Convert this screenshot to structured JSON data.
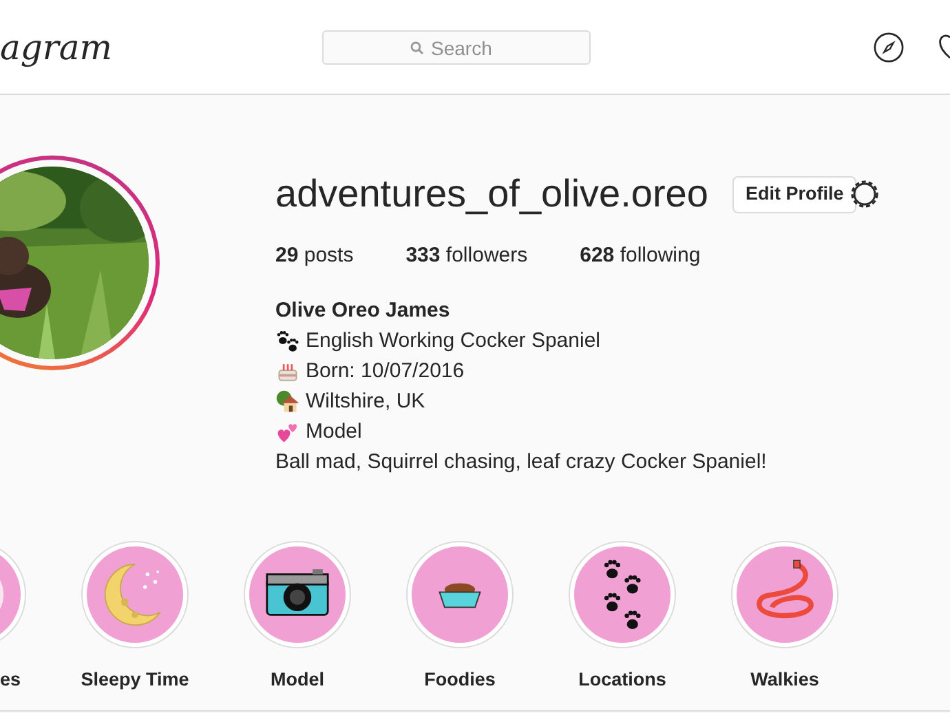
{
  "header": {
    "logo": "agram",
    "search": {
      "placeholder": "Search"
    }
  },
  "profile": {
    "username": "adventures_of_olive.oreo",
    "edit_button": "Edit Profile",
    "stats": [
      {
        "count": "29",
        "label": "posts"
      },
      {
        "count": "333",
        "label": "followers"
      },
      {
        "count": "628",
        "label": "following"
      }
    ],
    "name": "Olive Oreo James",
    "bio": [
      {
        "kind": "paws",
        "text": "English Working Cocker Spaniel"
      },
      {
        "kind": "cake",
        "text": "Born: 10/07/2016"
      },
      {
        "kind": "house",
        "text": "Wiltshire, UK"
      },
      {
        "kind": "hearts",
        "text": "Model"
      },
      {
        "kind": "plain",
        "text": "Ball mad, Squirrel chasing, leaf crazy Cocker Spaniel!"
      }
    ]
  },
  "highlights": [
    {
      "kind": "rings",
      "label": "es"
    },
    {
      "kind": "moon",
      "label": "Sleepy Time"
    },
    {
      "kind": "camera",
      "label": "Model"
    },
    {
      "kind": "bowl",
      "label": "Foodies"
    },
    {
      "kind": "paws",
      "label": "Locations"
    },
    {
      "kind": "leash",
      "label": "Walkies"
    }
  ]
}
